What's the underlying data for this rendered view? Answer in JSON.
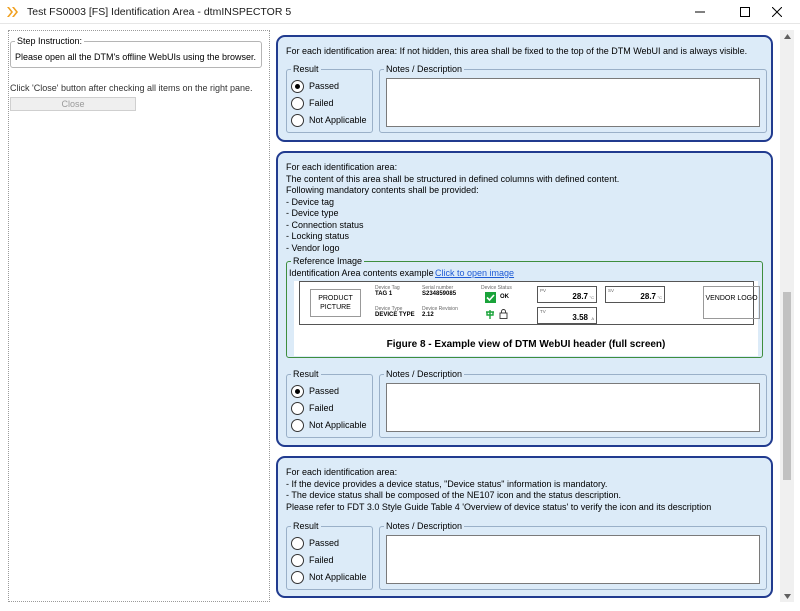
{
  "window": {
    "title": "Test FS0003 [FS] Identification Area - dtmINSPECTOR 5"
  },
  "left_pane": {
    "step_legend": "Step Instruction:",
    "step_text": "Please open all the DTM's offline WebUIs using the browser.",
    "hint": "Click 'Close' button after checking all items on the right pane.",
    "close_label": "Close"
  },
  "labels": {
    "result": "Result",
    "notes": "Notes / Description",
    "passed": "Passed",
    "failed": "Failed",
    "not_applicable": "Not Applicable"
  },
  "cards": [
    {
      "lines": [
        "For each identification area: If not hidden, this area shall be fixed to the top of the DTM WebUI and is always visible."
      ],
      "selected": "Passed"
    },
    {
      "lines": [
        "For each identification area:",
        "The content of this area shall be structured in defined columns with defined content.",
        "Following mandatory contents shall be provided:",
        "- Device tag",
        "- Device type",
        "- Connection status",
        "- Locking status",
        "- Vendor logo"
      ],
      "selected": "Passed"
    },
    {
      "lines": [
        "For each identification area:",
        "- If the device provides a device status, \"Device status\" information is mandatory.",
        "- The device status shall be composed of the NE107 icon and the status description.",
        "Please refer to FDT 3.0 Style Guide Table 4 'Overview of device status' to verify the icon and its description"
      ],
      "selected": ""
    }
  ],
  "reference": {
    "legend": "Reference Image",
    "caption": "Identification Area contents example",
    "link": "Click to open image",
    "figure_caption": "Figure 8 - Example view of DTM WebUI header (full screen)",
    "header": {
      "product": "PRODUCT PICTURE",
      "vendor": "VENDOR LOGO",
      "tag_label": "Device Tag",
      "tag_value": "TAG 1",
      "serial_label": "Serial number",
      "serial_value": "S234859085",
      "status_label": "Device Status",
      "status_value": "OK",
      "type_label": "Device Type",
      "type_value": "DEVICE TYPE",
      "rev_label": "Device Revision",
      "rev_value": "2.12",
      "pv_label": "PV",
      "pv_value": "28.7",
      "sv_label": "SV",
      "sv_value": "28.7",
      "tv_label": "TV",
      "tv_value": "3.58",
      "pv_unit": "°C",
      "sv_unit": "°C",
      "tv_unit": "A"
    }
  },
  "colors": {
    "card_bg": "#dcebf8",
    "card_border": "#213b8f",
    "link": "#1e5bd6",
    "ok_green": "#1aa33a"
  }
}
